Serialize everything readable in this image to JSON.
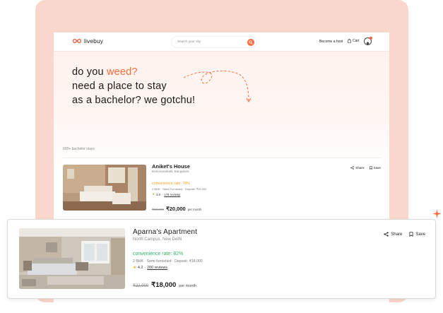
{
  "brand": {
    "name": "livebuy",
    "accent": "#ff6b3d"
  },
  "navbar": {
    "search_placeholder": "Search your city",
    "become_host": "Become a host",
    "cart": "Cart"
  },
  "hero": {
    "line1_prefix": "do you ",
    "line1_accent": "weed?",
    "line2": "need a place to stay",
    "line3": "as a bachelor? we gotchu!"
  },
  "listing_count": "600+ bachelor stays",
  "listings": [
    {
      "title": "Aniket's House",
      "location": "Bommanahalli, Bangalore",
      "convenience": "convenience rate: 78%",
      "specs": "2 BHK · Semi-Furnished · Deposit: ₹30,000",
      "rating": "3.8",
      "reviews": "178 reviews",
      "old_price": "₹30,000",
      "price": "₹20,000",
      "per": "per month",
      "share": "Share",
      "save": "Save",
      "convenience_color": "#f0a020"
    },
    {
      "title": "Aparna's Apartment",
      "location": "North Campus, New Delhi",
      "convenience": "convenience rate: 82%",
      "specs": "2 BHK · Semi-furnished · Deposit: ₹18,000",
      "rating": "4.2",
      "reviews": "200 reviews",
      "old_price": "₹22,000",
      "price": "₹18,000",
      "per": "per month",
      "share": "Share",
      "save": "Save",
      "convenience_color": "#2fb56a"
    }
  ]
}
